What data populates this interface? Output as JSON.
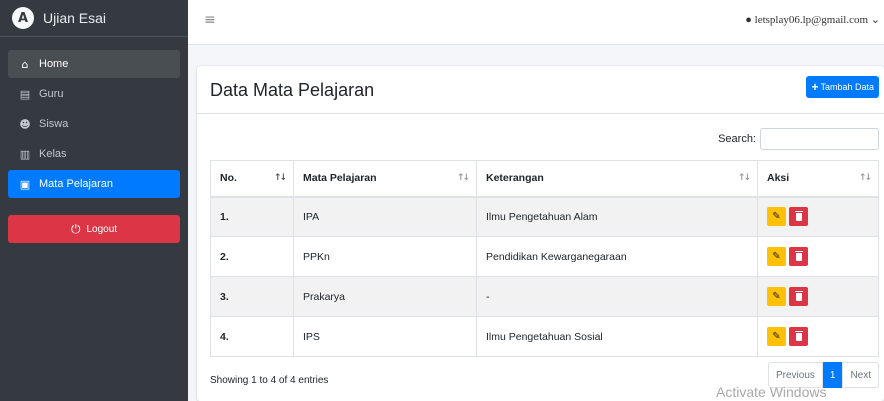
{
  "brand": {
    "logo_letter": "A",
    "title": "Ujian Esai"
  },
  "sidebar": {
    "items": [
      {
        "label": "Home",
        "icon": "home-icon",
        "glyph": "⌂"
      },
      {
        "label": "Guru",
        "icon": "chalkboard-teacher-icon",
        "glyph": "▤"
      },
      {
        "label": "Siswa",
        "icon": "users-icon",
        "glyph": "☻"
      },
      {
        "label": "Kelas",
        "icon": "building-icon",
        "glyph": "▥"
      },
      {
        "label": "Mata Pelajaran",
        "icon": "book-icon",
        "glyph": "▣"
      }
    ],
    "logout_label": "Logout",
    "logout_icon": "power-icon"
  },
  "topbar": {
    "menu_icon": "hamburger-icon",
    "user_email": "letsplay06.lp@gmail.com"
  },
  "card": {
    "title": "Data Mata Pelajaran",
    "add_button_label": "Tambah Data",
    "search_label": "Search:",
    "search_value": ""
  },
  "table": {
    "headers": [
      "No.",
      "Mata Pelajaran",
      "Keterangan",
      "Aksi"
    ],
    "rows": [
      {
        "no": "1.",
        "mapel": "IPA",
        "keterangan": "Ilmu Pengetahuan Alam"
      },
      {
        "no": "2.",
        "mapel": "PPKn",
        "keterangan": "Pendidikan Kewarganegaraan"
      },
      {
        "no": "3.",
        "mapel": "Prakarya",
        "keterangan": "-"
      },
      {
        "no": "4.",
        "mapel": "IPS",
        "keterangan": "Ilmu Pengetahuan Sosial"
      }
    ]
  },
  "footer": {
    "info": "Showing 1 to 4 of 4 entries",
    "pagination": {
      "previous": "Previous",
      "current": "1",
      "next": "Next"
    }
  },
  "watermark": "Activate Windows",
  "colors": {
    "sidebar_bg": "#343a40",
    "primary": "#007bff",
    "danger": "#dc3545",
    "warning": "#ffc107"
  }
}
